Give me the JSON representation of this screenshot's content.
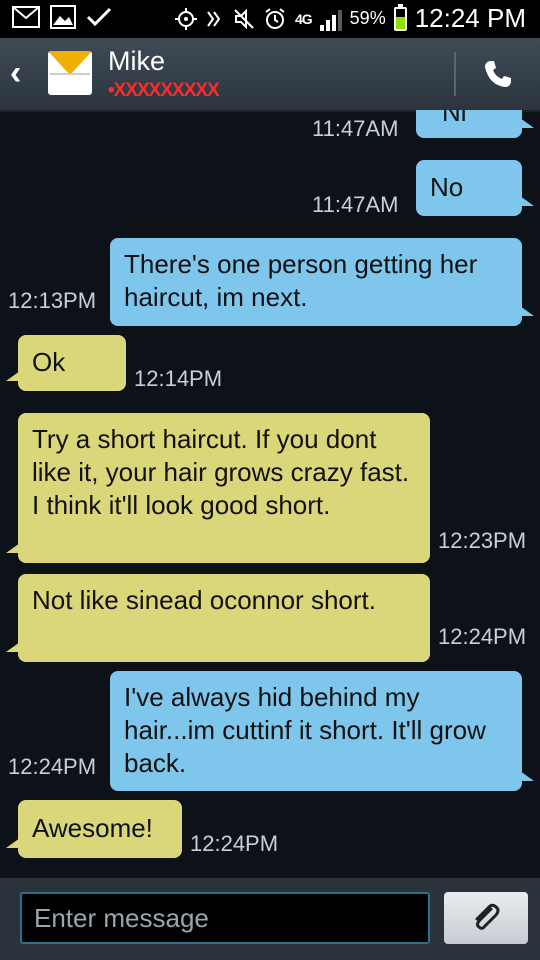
{
  "status_bar": {
    "battery_text": "59%",
    "battery_level": 0.59,
    "time": "12:24 PM",
    "network": "4G",
    "signal_bars": 3,
    "icons_left": [
      "mail-icon",
      "image-icon",
      "check-icon"
    ],
    "icons_right": [
      "gps-icon",
      "vibrate-icon",
      "silent-icon",
      "alarm-icon",
      "4g-icon",
      "signal-icon",
      "battery-icon"
    ],
    "battery_color": "#8fe000"
  },
  "header": {
    "contact_name": "Mike",
    "contact_number": "•XXXXXXXXX",
    "back_icon": "back-chevron-icon",
    "avatar_icon": "envelope-icon",
    "call_icon": "phone-icon"
  },
  "messages": [
    {
      "direction": "out",
      "text": "Ni",
      "time": "11:47AM"
    },
    {
      "direction": "out",
      "text": "No",
      "time": "11:47AM"
    },
    {
      "direction": "out",
      "text": "There's one person getting her haircut, im next.",
      "time": "12:13PM"
    },
    {
      "direction": "in",
      "text": "Ok",
      "time": "12:14PM"
    },
    {
      "direction": "in",
      "text": "Try a short haircut. If you dont like it, your hair grows crazy fast. I think it'll look good short.",
      "time": "12:23PM"
    },
    {
      "direction": "in",
      "text": "Not like sinead oconnor short.",
      "time": "12:24PM"
    },
    {
      "direction": "out",
      "text": "I've always hid behind my hair...im cuttinf it short. It'll grow back.",
      "time": "12:24PM"
    },
    {
      "direction": "in",
      "text": "Awesome!",
      "time": "12:24PM"
    }
  ],
  "composer": {
    "placeholder": "Enter message",
    "attach_icon": "paperclip-icon"
  },
  "colors": {
    "outgoing_bubble": "#7fc6ec",
    "incoming_bubble": "#d9d77a",
    "background": "#0d1218",
    "contact_number": "#ff2b2b"
  }
}
